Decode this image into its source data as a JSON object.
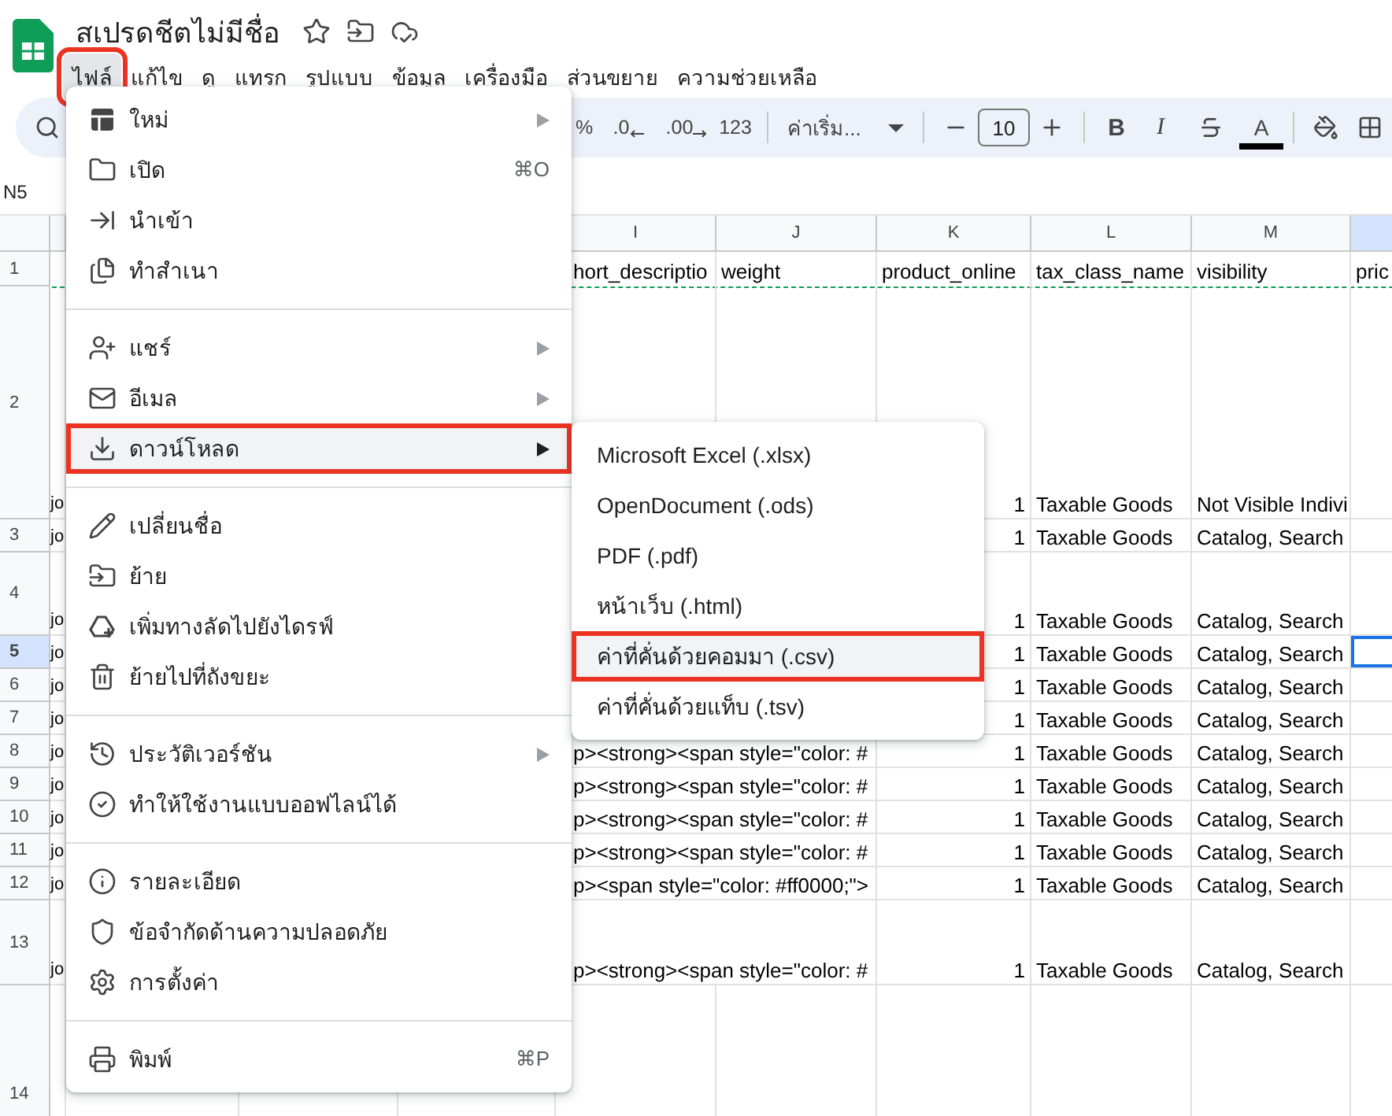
{
  "document": {
    "title": "สเปรดชีตไม่มีชื่อ"
  },
  "menu_bar": [
    {
      "label": "ไฟล์",
      "selected": true,
      "outlined": true
    },
    {
      "label": "แก้ไข",
      "selected": false,
      "outlined": false
    },
    {
      "label": "ดู",
      "selected": false,
      "outlined": false
    },
    {
      "label": "แทรก",
      "selected": false,
      "outlined": false
    },
    {
      "label": "รูปแบบ",
      "selected": false,
      "outlined": false
    },
    {
      "label": "ข้อมูล",
      "selected": false,
      "outlined": false
    },
    {
      "label": "เครื่องมือ",
      "selected": false,
      "outlined": false
    },
    {
      "label": "ส่วนขยาย",
      "selected": false,
      "outlined": false
    },
    {
      "label": "ความช่วยเหลือ",
      "selected": false,
      "outlined": false
    }
  ],
  "toolbar": {
    "formats": [
      {
        "kind": "percent",
        "label": "%"
      },
      {
        "kind": "decrease_decimal",
        "label": ".0"
      },
      {
        "kind": "increase_decimal",
        "label": ".00"
      },
      {
        "kind": "number",
        "label": "123"
      }
    ],
    "font": "ค่าเริ่ม...",
    "font_size": "10",
    "styles": [
      {
        "kind": "bold",
        "label": "B"
      },
      {
        "kind": "italic",
        "label": "I"
      }
    ],
    "text_color": "A"
  },
  "name_box": "N5",
  "columns": [
    {
      "letter": "I",
      "selected": false
    },
    {
      "letter": "J",
      "selected": false
    },
    {
      "letter": "K",
      "selected": false
    },
    {
      "letter": "L",
      "selected": false
    },
    {
      "letter": "M",
      "selected": false
    },
    {
      "selected": true
    }
  ],
  "rows": [
    {
      "number": "1",
      "kind": "labels",
      "selected": false,
      "dashed_outline": true,
      "cells": {
        "I": "hort_descriptio",
        "J": "weight",
        "K": "product_online",
        "L": "tax_class_name",
        "M": "visibility",
        "N": "pric"
      }
    },
    {
      "number": "2",
      "kind": "data",
      "selected": false,
      "cells": {
        "column_1": "jo",
        "K": "1",
        "L": "Taxable Goods",
        "M": "Not Visible Indivi"
      }
    },
    {
      "number": "3",
      "kind": "data",
      "selected": false,
      "cells": {
        "column_1": "jo",
        "K": "1",
        "L": "Taxable Goods",
        "M": "Catalog, Search"
      }
    },
    {
      "number": "4",
      "kind": "data",
      "selected": false,
      "cells": {
        "column_1": "jo",
        "K": "1",
        "L": "Taxable Goods",
        "M": "Catalog, Search"
      }
    },
    {
      "number": "5",
      "kind": "data",
      "selected": true,
      "cells": {
        "column_1": "jo",
        "K": "1",
        "L": "Taxable Goods",
        "M": "Catalog, Search"
      }
    },
    {
      "number": "6",
      "kind": "data",
      "selected": false,
      "cells": {
        "column_1": "jo",
        "K": "1",
        "L": "Taxable Goods",
        "M": "Catalog, Search"
      }
    },
    {
      "number": "7",
      "kind": "data",
      "selected": false,
      "cells": {
        "column_1": "jo",
        "K": "1",
        "L": "Taxable Goods",
        "M": "Catalog, Search"
      }
    },
    {
      "number": "8",
      "kind": "data",
      "selected": false,
      "cells": {
        "column_1": "jo",
        "I": "p><strong><span style=\"color: #",
        "K": "1",
        "L": "Taxable Goods",
        "M": "Catalog, Search"
      }
    },
    {
      "number": "9",
      "kind": "data",
      "selected": false,
      "cells": {
        "column_1": "jo",
        "I": "p><strong><span style=\"color: #",
        "K": "1",
        "L": "Taxable Goods",
        "M": "Catalog, Search"
      }
    },
    {
      "number": "10",
      "kind": "data",
      "selected": false,
      "cells": {
        "column_1": "jo",
        "I": "p><strong><span style=\"color: #",
        "K": "1",
        "L": "Taxable Goods",
        "M": "Catalog, Search"
      }
    },
    {
      "number": "11",
      "kind": "data",
      "selected": false,
      "cells": {
        "column_1": "jo",
        "I": "p><strong><span style=\"color: #",
        "K": "1",
        "L": "Taxable Goods",
        "M": "Catalog, Search"
      }
    },
    {
      "number": "12",
      "kind": "data",
      "selected": false,
      "cells": {
        "column_1": "jo",
        "I": "p><span style=\"color: #ff0000;\">",
        "K": "1",
        "L": "Taxable Goods",
        "M": "Catalog, Search"
      }
    },
    {
      "number": "13",
      "kind": "data",
      "selected": false,
      "cells": {
        "column_1": "jo",
        "I": "p><strong><span style=\"color: #",
        "K": "1",
        "L": "Taxable Goods",
        "M": "Catalog, Search"
      }
    },
    {
      "number": "14",
      "kind": "data",
      "selected": false,
      "cells": {}
    }
  ],
  "file_menu": {
    "items": [
      {
        "kind": "item",
        "label": "ใหม่",
        "has_submenu": true,
        "selected": false,
        "outlined": false
      },
      {
        "kind": "item",
        "label": "เปิด",
        "shortcut": "⌘O",
        "selected": false,
        "outlined": false
      },
      {
        "kind": "item",
        "label": "นำเข้า",
        "selected": false,
        "outlined": false
      },
      {
        "kind": "item",
        "label": "ทำสำเนา",
        "selected": false,
        "outlined": false
      },
      {
        "kind": "divider"
      },
      {
        "kind": "item",
        "label": "แชร์",
        "has_submenu": true,
        "selected": false,
        "outlined": false
      },
      {
        "kind": "item",
        "label": "อีเมล",
        "has_submenu": true,
        "selected": false,
        "outlined": false
      },
      {
        "kind": "item",
        "label": "ดาวน์โหลด",
        "has_submenu": true,
        "selected": true,
        "outlined": true
      },
      {
        "kind": "divider"
      },
      {
        "kind": "item",
        "label": "เปลี่ยนชื่อ",
        "selected": false,
        "outlined": false
      },
      {
        "kind": "item",
        "label": "ย้าย",
        "selected": false,
        "outlined": false
      },
      {
        "kind": "item",
        "label": "เพิ่มทางลัดไปยังไดรฟ์",
        "selected": false,
        "outlined": false
      },
      {
        "kind": "item",
        "label": "ย้ายไปที่ถังขยะ",
        "selected": false,
        "outlined": false
      },
      {
        "kind": "divider"
      },
      {
        "kind": "item",
        "label": "ประวัติเวอร์ชัน",
        "has_submenu": true,
        "selected": false,
        "outlined": false
      },
      {
        "kind": "item",
        "label": "ทำให้ใช้งานแบบออฟไลน์ได้",
        "selected": false,
        "outlined": false
      },
      {
        "kind": "divider"
      },
      {
        "kind": "item",
        "label": "รายละเอียด",
        "selected": false,
        "outlined": false
      },
      {
        "kind": "item",
        "label": "ข้อจำกัดด้านความปลอดภัย",
        "selected": false,
        "outlined": false
      },
      {
        "kind": "item",
        "label": "การตั้งค่า",
        "selected": false,
        "outlined": false
      },
      {
        "kind": "divider"
      },
      {
        "kind": "item",
        "label": "พิมพ์",
        "shortcut": "⌘P",
        "selected": false,
        "outlined": false
      }
    ]
  },
  "download_submenu": {
    "items": [
      {
        "label": "Microsoft Excel (.xlsx)",
        "selected": false,
        "outlined": false
      },
      {
        "label": "OpenDocument (.ods)",
        "selected": false,
        "outlined": false
      },
      {
        "label": "PDF (.pdf)",
        "selected": false,
        "outlined": false
      },
      {
        "label": "หน้าเว็บ (.html)",
        "selected": false,
        "outlined": false
      },
      {
        "label": "ค่าที่คั่นด้วยคอมมา (.csv)",
        "selected": true,
        "outlined": true
      },
      {
        "label": "ค่าที่คั่นด้วยแท็บ (.tsv)",
        "selected": false,
        "outlined": false
      }
    ]
  }
}
